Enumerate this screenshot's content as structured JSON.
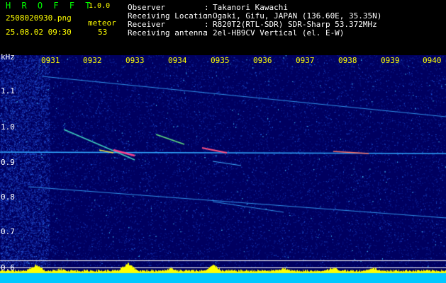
{
  "app": {
    "title": "H R O F F T",
    "version": "1.0.0"
  },
  "file": {
    "name": "2508020930.png",
    "datetime": "25.08.02 09:30"
  },
  "meteor": {
    "label": "meteor",
    "count": "53"
  },
  "info": [
    {
      "label": "Observer",
      "value": "Takanori Kawachi"
    },
    {
      "label": "Receiving Location",
      "value": "Ogaki, Gifu, JAPAN (136.60E, 35.35N)"
    },
    {
      "label": "Receiver",
      "value": "R820T2(RTL-SDR) SDR-Sharp 53.372MHz"
    },
    {
      "label": "Receiving antenna",
      "value": "2el-HB9CV Vertical (el. E-W)"
    }
  ],
  "axis": {
    "unit": "kHz",
    "x_ticks": [
      "0931",
      "0932",
      "0933",
      "0934",
      "0935",
      "0936",
      "0937",
      "0938",
      "0939",
      "0940"
    ],
    "y_ticks": [
      "1.1",
      "1.0",
      "0.9",
      "0.8",
      "0.7",
      "0.6"
    ]
  },
  "colors": {
    "header_text": "#ffff00",
    "app_title": "#00ff00",
    "background": "#000080"
  }
}
